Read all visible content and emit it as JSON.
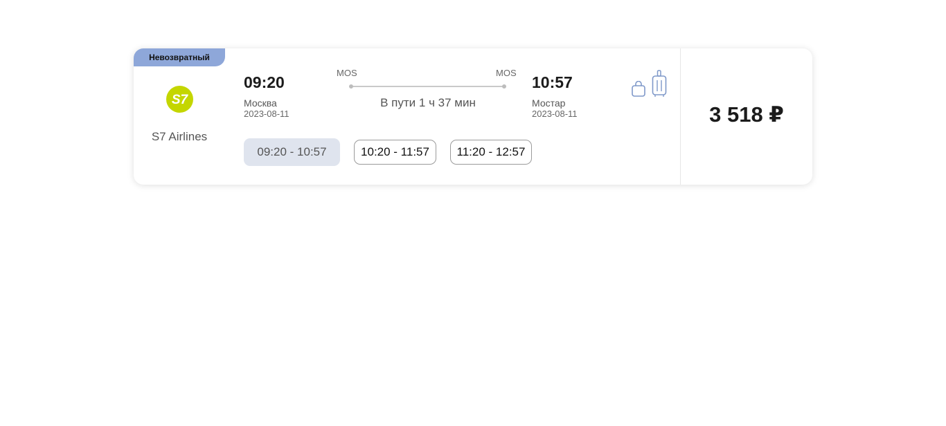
{
  "ticket": {
    "badge": "Невозвратный",
    "airline": {
      "name": "S7 Airlines",
      "logo_text": "S7",
      "logo_color": "#c4d600"
    },
    "departure": {
      "time": "09:20",
      "city": "Москва",
      "date": "2023-08-11",
      "code": "MOS"
    },
    "arrival": {
      "time": "10:57",
      "city": "Мостар",
      "date": "2023-08-11",
      "code": "MOS"
    },
    "duration": "В пути 1 ч 37 мин",
    "baggage_icons": [
      "bag-icon",
      "suitcase-icon"
    ],
    "time_options": [
      {
        "label": "09:20 - 10:57",
        "selected": true
      },
      {
        "label": "10:20 - 11:57",
        "selected": false
      },
      {
        "label": "11:20 - 12:57",
        "selected": false
      }
    ],
    "price": "3 518 ₽"
  },
  "colors": {
    "badge_bg": "#8ea7d9",
    "selected_option_bg": "#dfe4ee",
    "icon_stroke": "#7e98c9"
  }
}
